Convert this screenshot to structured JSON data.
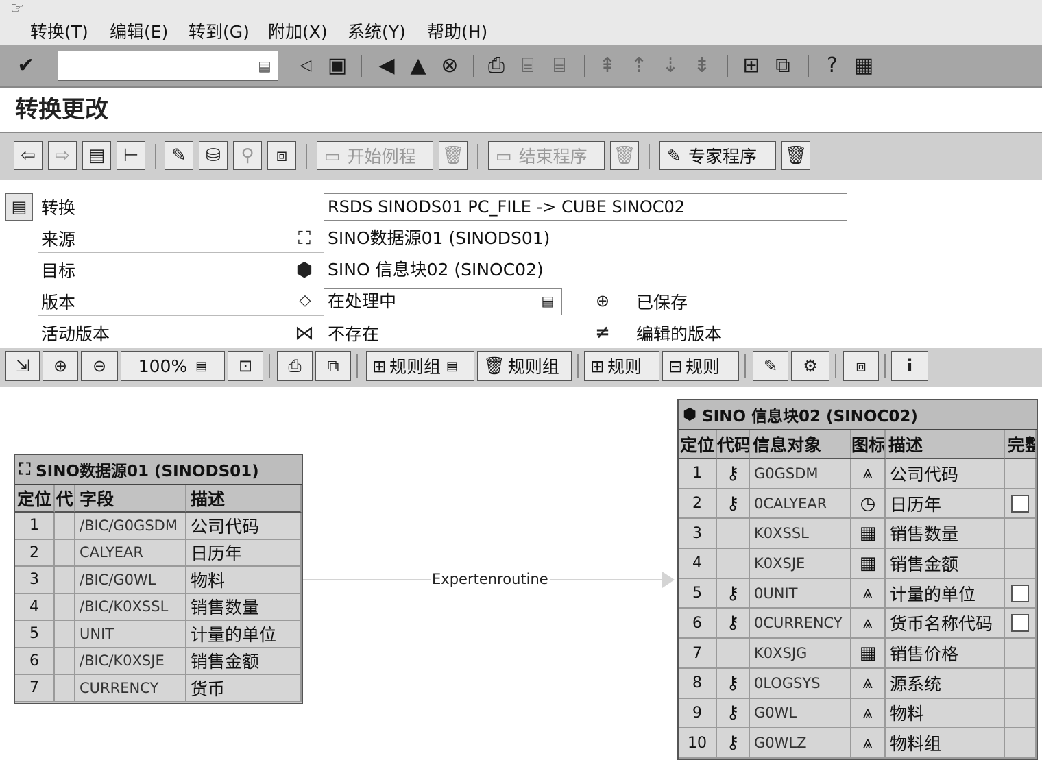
{
  "menu": [
    "转换(T)",
    "编辑(E)",
    "转到(G)",
    "附加(X)",
    "系统(Y)",
    "帮助(H)"
  ],
  "page_title": "转换更改",
  "app_toolbar": {
    "start_routine": "开始例程",
    "end_routine": "结束程序",
    "expert_routine": "专家程序"
  },
  "header": {
    "transform_label": "转换",
    "transform_value": "RSDS SINODS01 PC_FILE -> CUBE SINOC02",
    "source_label": "来源",
    "source_value": "SINO数据源01 (SINODS01)",
    "target_label": "目标",
    "target_value": "SINO 信息块02 (SINOC02)",
    "version_label": "版本",
    "version_value": "在处理中",
    "saved_label": "已保存",
    "active_label": "活动版本",
    "active_value": "不存在",
    "edited_label": "编辑的版本"
  },
  "graph_toolbar": {
    "zoom": "100%",
    "rule_group_label": "规则组",
    "rule_label": "规则"
  },
  "connector_label": "Expertenroutine",
  "source_table": {
    "title": "SINO数据源01 (SINODS01)",
    "columns": [
      "定位",
      "代",
      "字段",
      "描述"
    ],
    "rows": [
      {
        "pos": "1",
        "field": "/BIC/G0GSDM",
        "desc": "公司代码"
      },
      {
        "pos": "2",
        "field": "CALYEAR",
        "desc": "日历年"
      },
      {
        "pos": "3",
        "field": "/BIC/G0WL",
        "desc": "物料"
      },
      {
        "pos": "4",
        "field": "/BIC/K0XSSL",
        "desc": "销售数量"
      },
      {
        "pos": "5",
        "field": "UNIT",
        "desc": "计量的单位"
      },
      {
        "pos": "6",
        "field": "/BIC/K0XSJE",
        "desc": "销售金额"
      },
      {
        "pos": "7",
        "field": "CURRENCY",
        "desc": "货币"
      }
    ]
  },
  "target_table": {
    "title": "SINO 信息块02 (SINOC02)",
    "columns": [
      "定位",
      "代码",
      "信息对象",
      "图标",
      "描述",
      "完整"
    ],
    "rows": [
      {
        "pos": "1",
        "key": true,
        "obj": "G0GSDM",
        "icon": "char-icon",
        "desc": "公司代码",
        "check": false
      },
      {
        "pos": "2",
        "key": true,
        "obj": "0CALYEAR",
        "icon": "time-icon",
        "desc": "日历年",
        "check": true
      },
      {
        "pos": "3",
        "key": false,
        "obj": "K0XSSL",
        "icon": "keyfigure-icon",
        "desc": "销售数量",
        "check": false
      },
      {
        "pos": "4",
        "key": false,
        "obj": "K0XSJE",
        "icon": "keyfigure-icon",
        "desc": "销售金额",
        "check": false
      },
      {
        "pos": "5",
        "key": true,
        "obj": "0UNIT",
        "icon": "unit-icon",
        "desc": "计量的单位",
        "check": true
      },
      {
        "pos": "6",
        "key": true,
        "obj": "0CURRENCY",
        "icon": "unit-icon",
        "desc": "货币名称代码",
        "check": true
      },
      {
        "pos": "7",
        "key": false,
        "obj": "K0XSJG",
        "icon": "keyfigure-icon",
        "desc": "销售价格",
        "check": false
      },
      {
        "pos": "8",
        "key": true,
        "obj": "0LOGSYS",
        "icon": "char-icon",
        "desc": "源系统",
        "check": false
      },
      {
        "pos": "9",
        "key": true,
        "obj": "G0WL",
        "icon": "char-icon",
        "desc": "物料",
        "check": false
      },
      {
        "pos": "10",
        "key": true,
        "obj": "G0WLZ",
        "icon": "char-icon",
        "desc": "物料组",
        "check": false
      }
    ]
  }
}
